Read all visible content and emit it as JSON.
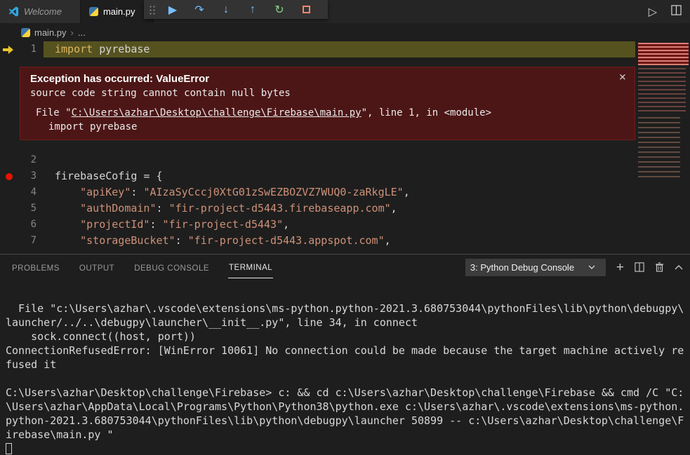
{
  "colors": {
    "editor_bg": "#1e1e1e",
    "tab_bar_bg": "#252526",
    "exception_bg": "#4d1616",
    "current_line_highlight": "#55521f",
    "breakpoint_red": "#e51400",
    "debug_blue": "#75beff",
    "debug_green": "#89d185",
    "debug_red": "#f48771",
    "string_orange": "#ce9178",
    "keyword_gold": "#dcb65e"
  },
  "icons": {
    "run": "▷",
    "continue": "▶",
    "step_over": "↷",
    "step_into": "↓",
    "step_out": "↑",
    "restart": "↻",
    "plus": "+",
    "close": "×",
    "breadcrumb_sep": "›"
  },
  "tabs": {
    "welcome": {
      "label": "Welcome"
    },
    "main": {
      "label": "main.py"
    }
  },
  "breadcrumb": {
    "file": "main.py",
    "more": "..."
  },
  "editor": {
    "lines": [
      {
        "num": "1",
        "current": true,
        "tokens": [
          {
            "t": "import",
            "c": "kw"
          },
          {
            "t": " pyrebase",
            "c": "plain"
          }
        ]
      },
      {
        "num": "2",
        "tokens": []
      },
      {
        "num": "3",
        "breakpoint": true,
        "tokens": [
          {
            "t": "firebaseCofig = {",
            "c": "plain"
          }
        ]
      },
      {
        "num": "4",
        "tokens": [
          {
            "t": "    ",
            "c": "plain"
          },
          {
            "t": "\"apiKey\"",
            "c": "str"
          },
          {
            "t": ": ",
            "c": "plain"
          },
          {
            "t": "\"AIzaSyCccj0XtG01zSwEZBOZVZ7WUQ0-zaRkgLE\"",
            "c": "str"
          },
          {
            "t": ",",
            "c": "plain"
          }
        ]
      },
      {
        "num": "5",
        "tokens": [
          {
            "t": "    ",
            "c": "plain"
          },
          {
            "t": "\"authDomain\"",
            "c": "str"
          },
          {
            "t": ": ",
            "c": "plain"
          },
          {
            "t": "\"fir-project-d5443.firebaseapp.com\"",
            "c": "str"
          },
          {
            "t": ",",
            "c": "plain"
          }
        ]
      },
      {
        "num": "6",
        "tokens": [
          {
            "t": "    ",
            "c": "plain"
          },
          {
            "t": "\"projectId\"",
            "c": "str"
          },
          {
            "t": ": ",
            "c": "plain"
          },
          {
            "t": "\"fir-project-d5443\"",
            "c": "str"
          },
          {
            "t": ",",
            "c": "plain"
          }
        ]
      },
      {
        "num": "7",
        "tokens": [
          {
            "t": "    ",
            "c": "plain"
          },
          {
            "t": "\"storageBucket\"",
            "c": "str"
          },
          {
            "t": ": ",
            "c": "plain"
          },
          {
            "t": "\"fir-project-d5443.appspot.com\"",
            "c": "str"
          },
          {
            "t": ",",
            "c": "plain"
          }
        ]
      }
    ]
  },
  "exception": {
    "title": "Exception has occurred: ValueError",
    "message": "source code string cannot contain null bytes",
    "frame": {
      "prefix": "File \"",
      "path": "C:\\Users\\azhar\\Desktop\\challenge\\Firebase\\main.py",
      "suffix": "\", line 1, in <module>"
    },
    "code": "import pyrebase"
  },
  "panel": {
    "tabs": [
      "PROBLEMS",
      "OUTPUT",
      "DEBUG CONSOLE",
      "TERMINAL"
    ],
    "active_tab": "TERMINAL",
    "console_dropdown": "3: Python Debug Console"
  },
  "terminal": {
    "lines": [
      "  File \"c:\\Users\\azhar\\.vscode\\extensions\\ms-python.python-2021.3.680753044\\pythonFiles\\lib\\python\\debugpy\\",
      "launcher/../..\\debugpy\\launcher\\__init__.py\", line 34, in connect",
      "    sock.connect((host, port))",
      "ConnectionRefusedError: [WinError 10061] No connection could be made because the target machine actively re",
      "fused it",
      "",
      "C:\\Users\\azhar\\Desktop\\challenge\\Firebase> c: && cd c:\\Users\\azhar\\Desktop\\challenge\\Firebase && cmd /C \"C:",
      "\\Users\\azhar\\AppData\\Local\\Programs\\Python\\Python38\\python.exe c:\\Users\\azhar\\.vscode\\extensions\\ms-python.",
      "python-2021.3.680753044\\pythonFiles\\lib\\python\\debugpy\\launcher 50899 -- c:\\Users\\azhar\\Desktop\\challenge\\F",
      "irebase\\main.py \""
    ]
  }
}
